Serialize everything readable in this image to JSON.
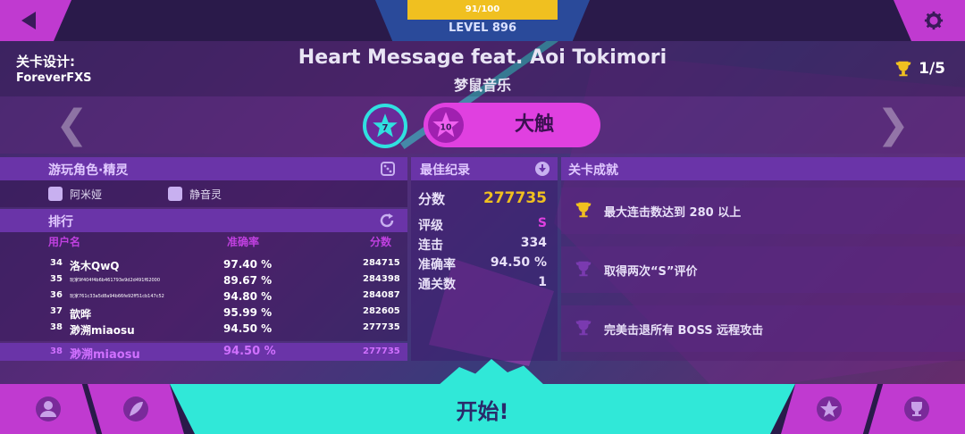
{
  "level": {
    "progress_text": "91/100",
    "progress_value": 0.91,
    "label": "LEVEL 896"
  },
  "header": {
    "designer_label": "关卡设计:",
    "designer_name": "ForeverFXS",
    "song_title": "Heart Message feat. Aoi Tokimori",
    "song_artist": "梦鼠音乐",
    "trophy_count": "1/5"
  },
  "difficulty": {
    "current_star": "7",
    "selected_star": "10",
    "selected_label": "大触"
  },
  "character": {
    "title": "游玩角色·精灵",
    "role": "阿米娅",
    "sprite": "静音灵"
  },
  "ranking": {
    "title": "排行",
    "columns": {
      "user": "用户名",
      "accuracy": "准确率",
      "score": "分数"
    },
    "rows": [
      {
        "rank": "34",
        "user": "洛木QwQ",
        "accuracy": "97.40 %",
        "score": "284715"
      },
      {
        "rank": "35",
        "user": "玩家9f404f4b6b461793e9d2d491f62000",
        "accuracy": "89.67 %",
        "score": "284398"
      },
      {
        "rank": "36",
        "user": "玩家761c33a5d8a94b66fe92ff51cb147c52",
        "accuracy": "94.80 %",
        "score": "284087"
      },
      {
        "rank": "37",
        "user": "歆晔",
        "accuracy": "95.99 %",
        "score": "282605"
      },
      {
        "rank": "38",
        "user": "渺溯miaosu",
        "accuracy": "94.50 %",
        "score": "277735"
      }
    ],
    "self": {
      "rank": "38",
      "user": "渺溯miaosu",
      "accuracy": "94.50 %",
      "score": "277735"
    }
  },
  "best": {
    "title": "最佳纪录",
    "score_label": "分数",
    "score_value": "277735",
    "grade_label": "评级",
    "grade_value": "S",
    "combo_label": "连击",
    "combo_value": "334",
    "accuracy_label": "准确率",
    "accuracy_value": "94.50 %",
    "clears_label": "通关数",
    "clears_value": "1"
  },
  "achievements": {
    "title": "关卡成就",
    "items": [
      {
        "text": "最大连击数达到 280 以上",
        "unlocked": true
      },
      {
        "text": "取得两次“S”评价",
        "unlocked": false
      },
      {
        "text": "完美击退所有 BOSS 远程攻击",
        "unlocked": false
      }
    ]
  },
  "start_label": "开始!",
  "colors": {
    "accent_cyan": "#30e8d8",
    "accent_magenta": "#c03ad0",
    "gold": "#f0c020",
    "panel_purple": "#6a34a8"
  }
}
